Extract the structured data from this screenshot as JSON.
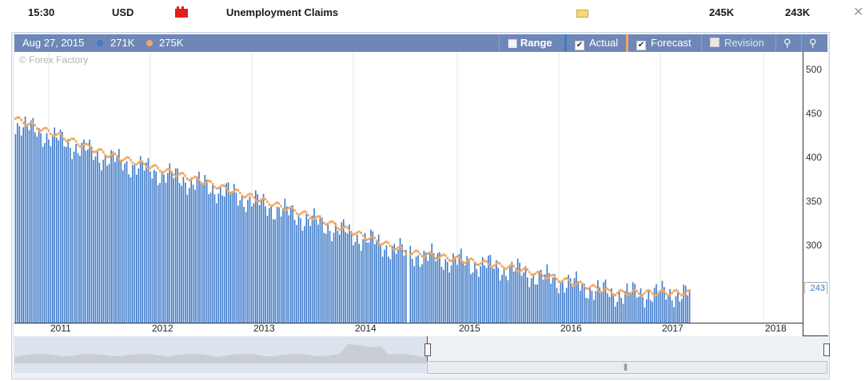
{
  "event_row": {
    "time": "15:30",
    "currency": "USD",
    "impact_icon": "high-impact-folder-icon",
    "title": "Unemployment Claims",
    "detail_icon": "folder-icon",
    "forecast": "245K",
    "previous": "243K",
    "close_icon": "close-icon"
  },
  "chart_header": {
    "date": "Aug 27, 2015",
    "actual_value": "271K",
    "forecast_value": "275K",
    "range_label": "Range",
    "actual_label": "Actual",
    "forecast_label": "Forecast",
    "revision_label": "Revision",
    "actual_checked": true,
    "forecast_checked": true,
    "revision_checked": false
  },
  "watermark": "© Forex Factory",
  "current_value_label": "243",
  "colors": {
    "actual": "#3d7ac9",
    "forecast": "#f0a860",
    "header": "#6f87b6"
  },
  "chart_data": {
    "type": "bar",
    "y_ticks": [
      "500",
      "450",
      "400",
      "350",
      "300",
      "250"
    ],
    "x_ticks": [
      "2011",
      "2012",
      "2013",
      "2014",
      "2015",
      "2016",
      "2017",
      "2018"
    ],
    "ylim": [
      212,
      520
    ],
    "x": [
      "2011",
      "2012",
      "2013",
      "2014",
      "2015",
      "2016",
      "2017"
    ],
    "series": [
      {
        "name": "Actual",
        "values": [
          445,
          400,
          368,
          330,
          290,
          272,
          245
        ]
      },
      {
        "name": "Forecast",
        "values": [
          450,
          405,
          372,
          335,
          292,
          275,
          246
        ]
      }
    ]
  }
}
